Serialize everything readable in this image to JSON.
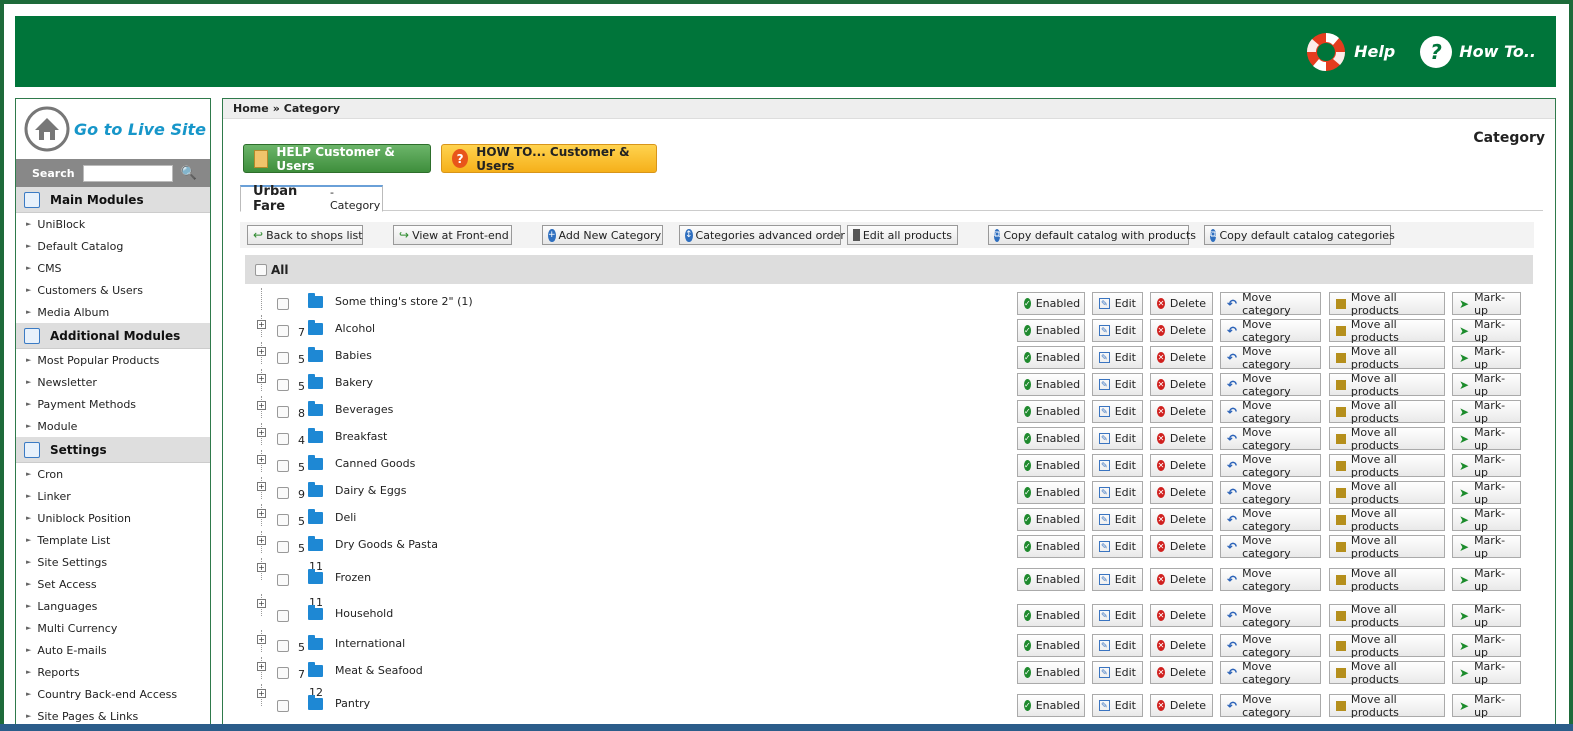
{
  "header": {
    "help_label": "Help",
    "howto_label": "How To..",
    "bg_color": "#00753a"
  },
  "sidebar": {
    "live_site": "Go to Live Site",
    "search_label": "Search",
    "search_value": "",
    "sections": [
      {
        "title": "Main Modules",
        "items": [
          "UniBlock",
          "Default Catalog",
          "CMS",
          "Customers & Users",
          "Media Album"
        ]
      },
      {
        "title": "Additional Modules",
        "items": [
          "Most Popular Products",
          "Newsletter",
          "Payment Methods",
          "Module"
        ]
      },
      {
        "title": "Settings",
        "items": [
          "Cron",
          "Linker",
          "Uniblock Position",
          "Template List",
          "Site Settings",
          "Set Access",
          "Languages",
          "Multi Currency",
          "Auto E-mails",
          "Reports",
          "Country Back-end Access",
          "Site Pages & Links"
        ]
      }
    ]
  },
  "breadcrumb": {
    "home": "Home",
    "sep": "»",
    "current": "Category"
  },
  "page_title": "Category",
  "help_button": "HELP Customer & Users",
  "howto_button": "HOW TO... Customer & Users",
  "tab": {
    "name": "Urban Fare",
    "sub": "- Category"
  },
  "toolbar": {
    "back": "Back to shops list",
    "frontend": "View at Front-end",
    "add": "Add New Category",
    "order": "Categories advanced order",
    "edit_all": "Edit all products",
    "copy_products": "Copy default catalog with products",
    "copy_categories": "Copy default catalog categories"
  },
  "all_label": "All",
  "actions": {
    "enabled": "Enabled",
    "edit": "Edit",
    "delete": "Delete",
    "move": "Move category",
    "move_products": "Move all products",
    "markup": "Mark-up"
  },
  "categories": [
    {
      "count": "",
      "name": "Some thing's store 2\" (1)",
      "expandable": false
    },
    {
      "count": "7",
      "name": "Alcohol",
      "expandable": true
    },
    {
      "count": "5",
      "name": "Babies",
      "expandable": true
    },
    {
      "count": "5",
      "name": "Bakery",
      "expandable": true
    },
    {
      "count": "8",
      "name": "Beverages",
      "expandable": true
    },
    {
      "count": "4",
      "name": "Breakfast",
      "expandable": true
    },
    {
      "count": "5",
      "name": "Canned Goods",
      "expandable": true
    },
    {
      "count": "9",
      "name": "Dairy & Eggs",
      "expandable": true
    },
    {
      "count": "5",
      "name": "Deli",
      "expandable": true
    },
    {
      "count": "5",
      "name": "Dry Goods & Pasta",
      "expandable": true
    },
    {
      "count": "11",
      "name": "Frozen",
      "expandable": true,
      "tall": true
    },
    {
      "count": "11",
      "name": "Household",
      "expandable": true,
      "tall": true
    },
    {
      "count": "5",
      "name": "International",
      "expandable": true
    },
    {
      "count": "7",
      "name": "Meat & Seafood",
      "expandable": true
    },
    {
      "count": "12",
      "name": "Pantry",
      "expandable": true,
      "tall": true
    }
  ]
}
